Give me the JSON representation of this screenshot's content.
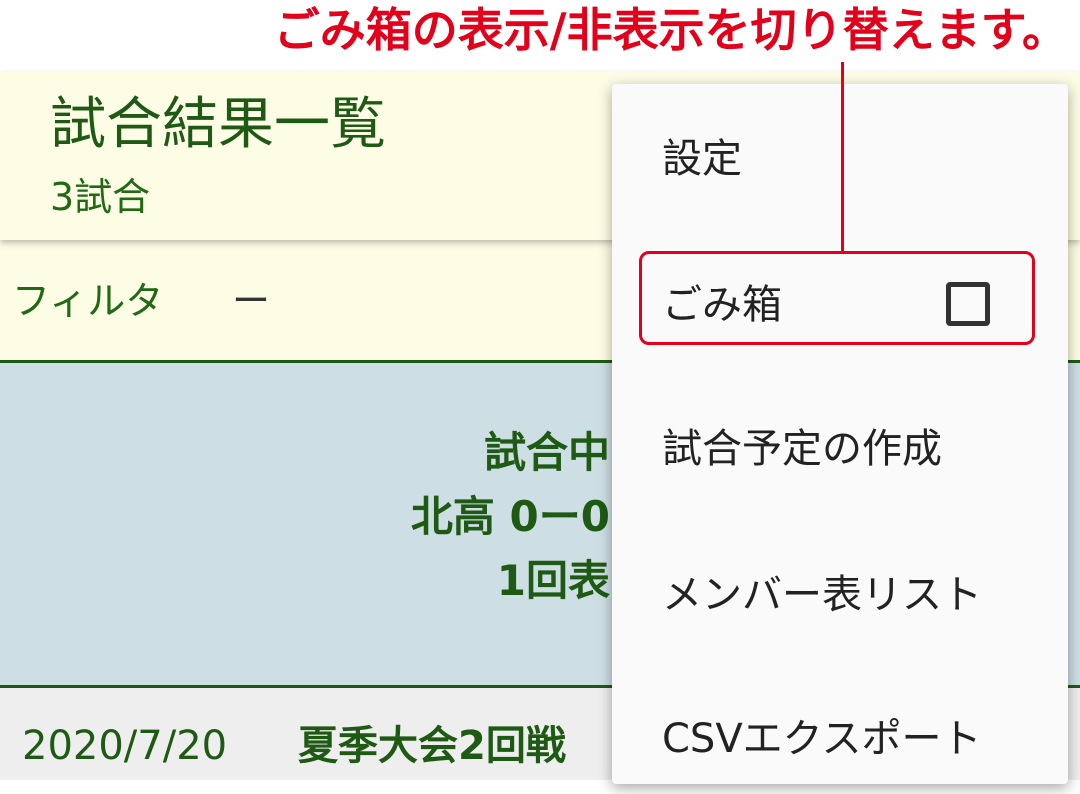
{
  "annotation": {
    "text": "ごみ箱の表示/非表示を切り替えます。",
    "color": "#e3001b"
  },
  "header": {
    "title": "試合結果一覧",
    "subtitle": "3試合"
  },
  "filter": {
    "label": "フィルタ",
    "value": "ー"
  },
  "game_card": {
    "status": "試合中",
    "score": "北高 0ー0",
    "inning": "1回表"
  },
  "game_row": {
    "date": "2020/7/20",
    "title": "夏季大会2回戦"
  },
  "menu": {
    "items": [
      {
        "label": "設定"
      },
      {
        "label": "ごみ箱",
        "checked": false
      },
      {
        "label": "試合予定の作成"
      },
      {
        "label": "メンバー表リスト"
      },
      {
        "label": "CSVエクスポート"
      }
    ]
  },
  "colors": {
    "appbar_bg": "#fdfde6",
    "primary_green": "#1f5a14",
    "card_bg": "#cddfe4",
    "annotation_red": "#e3001b"
  }
}
